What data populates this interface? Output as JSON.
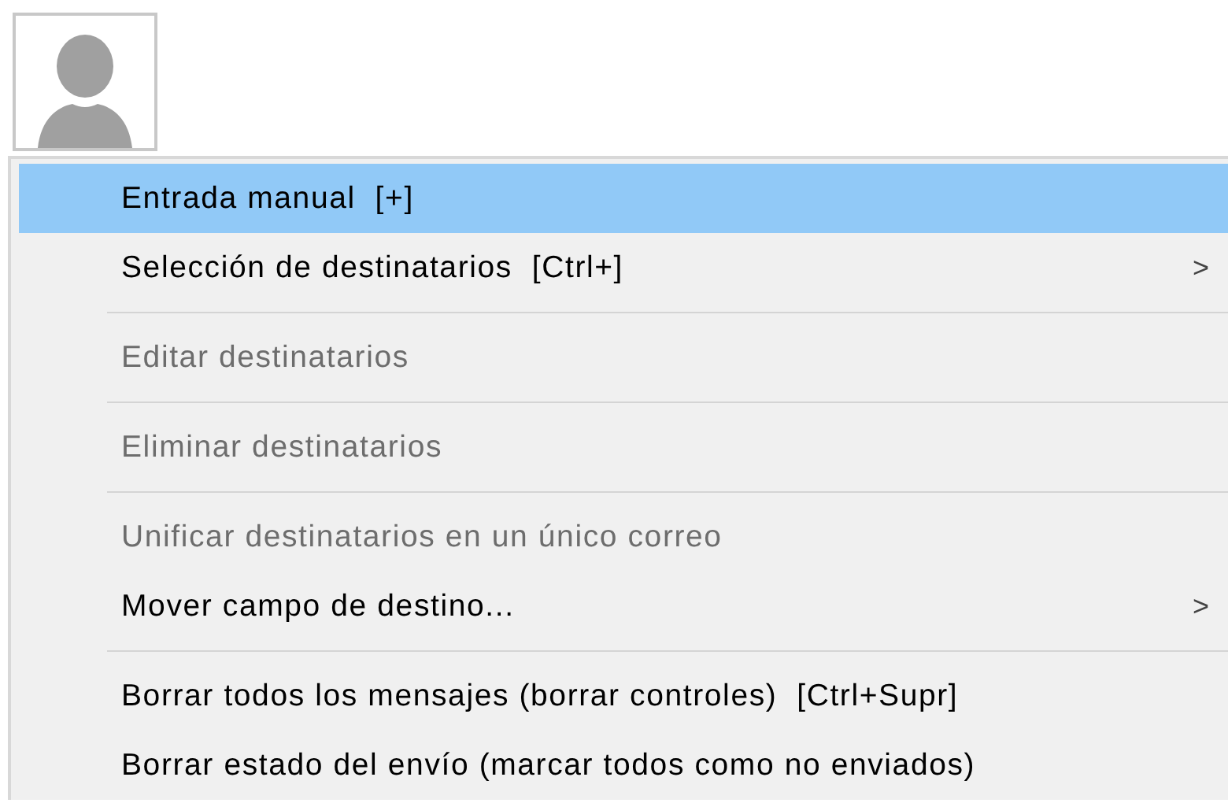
{
  "avatar": {
    "kind": "placeholder"
  },
  "menu": {
    "items": [
      {
        "kind": "item",
        "label": "Entrada manual  [+]",
        "selected": true,
        "disabled": false
      },
      {
        "kind": "item",
        "label": "Selección de destinatarios  [Ctrl+]",
        "selected": false,
        "disabled": false,
        "arrow": ">"
      },
      {
        "kind": "separator"
      },
      {
        "kind": "item",
        "label": "Editar destinatarios",
        "selected": false,
        "disabled": true
      },
      {
        "kind": "separator"
      },
      {
        "kind": "item",
        "label": "Eliminar destinatarios",
        "selected": false,
        "disabled": true
      },
      {
        "kind": "separator"
      },
      {
        "kind": "item",
        "label": "Unificar destinatarios en un único correo",
        "selected": false,
        "disabled": true
      },
      {
        "kind": "item",
        "label": "Mover campo de destino...",
        "selected": false,
        "disabled": false,
        "arrow": ">"
      },
      {
        "kind": "separator"
      },
      {
        "kind": "item",
        "label": "Borrar todos los mensajes (borrar controles)  [Ctrl+Supr]",
        "selected": false,
        "disabled": false
      },
      {
        "kind": "item",
        "label": "Borrar estado del envío (marcar todos como no enviados)",
        "selected": false,
        "disabled": false
      }
    ]
  }
}
